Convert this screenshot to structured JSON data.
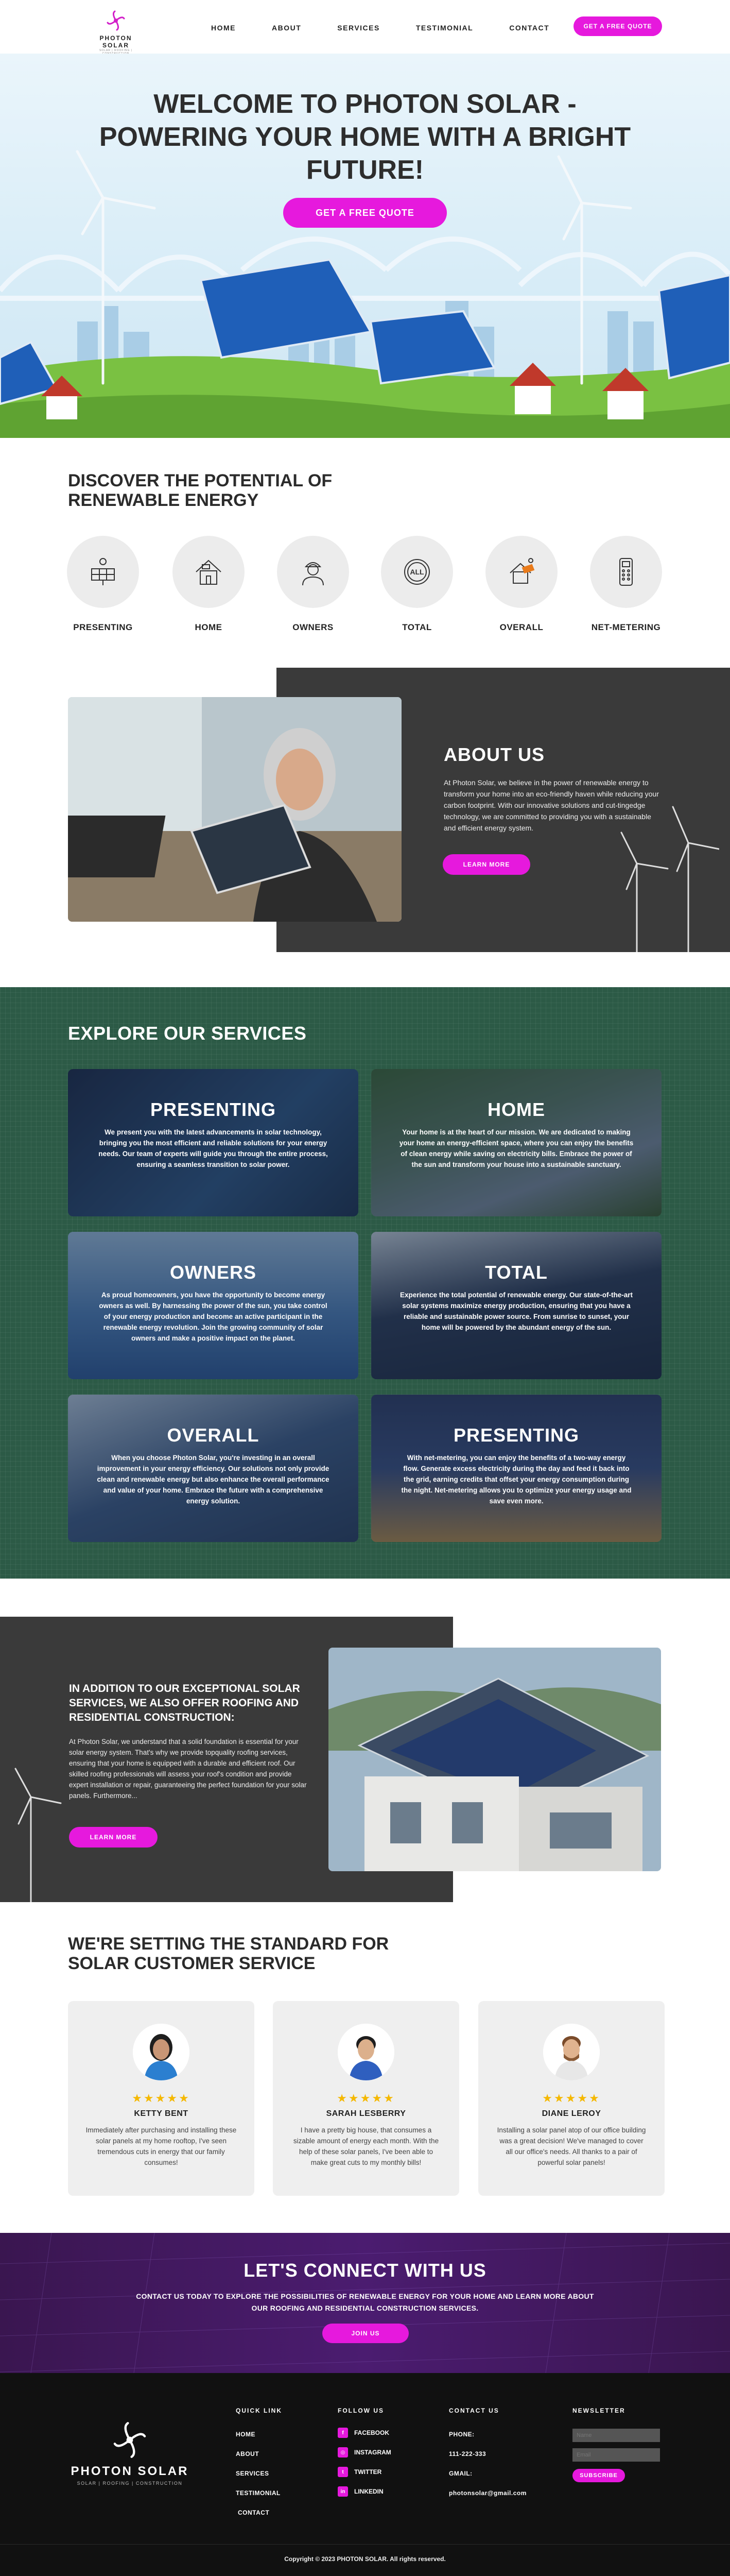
{
  "header": {
    "logo_text": "PHOTON SOLAR",
    "logo_sub": "SOLAR | ROOFING | CONSTRUCTION",
    "nav": [
      "HOME",
      "ABOUT",
      "SERVICES",
      "TESTIMONIAL",
      "CONTACT"
    ],
    "cta": "GET A FREE QUOTE"
  },
  "hero": {
    "title": "WELCOME TO PHOTON SOLAR - POWERING YOUR HOME WITH A BRIGHT FUTURE!",
    "cta": "GET A FREE QUOTE"
  },
  "discover": {
    "title": "DISCOVER THE POTENTIAL OF RENEWABLE ENERGY",
    "items": [
      "PRESENTING",
      "HOME",
      "OWNERS",
      "TOTAL",
      "OVERALL",
      "NET-METERING"
    ]
  },
  "about": {
    "title": "ABOUT US",
    "text": "At Photon Solar, we believe in the power of renewable energy to transform your home into an eco-friendly haven while reducing your carbon footprint. With our innovative solutions and cut-tingedge technology, we are committed to providing you with a sustainable and efficient energy system.",
    "cta": "LEARN MORE"
  },
  "services": {
    "title": "EXPLORE OUR SERVICES",
    "cards": [
      {
        "title": "PRESENTING",
        "text": "We present you with the latest advancements in solar technology, bringing you the most efficient and reliable solutions for your energy needs. Our team of experts will guide you through the entire process, ensuring a seamless transition to solar power."
      },
      {
        "title": "HOME",
        "text": "Your home is at the heart of our mission. We are dedicated to making your home an energy-efficient space, where you can enjoy the benefits of clean energy while saving on electricity bills. Embrace the power of the sun and transform your house into a sustainable sanctuary."
      },
      {
        "title": "OWNERS",
        "text": "As proud homeowners, you have the opportunity to become energy owners as well. By harnessing the power of the sun, you take control of your energy production and become an active participant in the renewable energy revolution. Join the growing community of solar owners and make a positive impact on the planet."
      },
      {
        "title": "TOTAL",
        "text": "Experience the total potential of renewable energy. Our state-of-the-art solar systems maximize energy production, ensuring that you have a reliable and sustainable power source. From sunrise to sunset, your home will be powered by the abundant energy of the sun."
      },
      {
        "title": "OVERALL",
        "text": "When you choose Photon Solar, you're investing in an overall improvement in your energy efficiency. Our solutions not only provide clean and renewable energy but also enhance the overall performance and value of your home. Embrace the future with a comprehensive energy solution."
      },
      {
        "title": "PRESENTING",
        "text": "With net-metering, you can enjoy the benefits of a two-way energy flow. Generate excess electricity during the day and feed it back into the grid, earning credits that offset your energy consumption during the night. Net-metering allows you to optimize your energy usage and save even more."
      }
    ]
  },
  "roofing": {
    "title": "IN ADDITION TO OUR EXCEPTIONAL SOLAR SERVICES, WE ALSO OFFER ROOFING AND RESIDENTIAL CONSTRUCTION:",
    "text": "At Photon Solar, we understand that a solid foundation is essential for your solar energy system. That's why we provide topquality roofing services, ensuring that your home is equipped with a durable and efficient roof. Our skilled roofing professionals will assess your roof's condition and provide expert installation or repair, guaranteeing the perfect foundation for your solar panels. Furthermore...",
    "cta": "LEARN MORE"
  },
  "testimonials": {
    "title": "WE'RE SETTING THE STANDARD FOR SOLAR CUSTOMER SERVICE",
    "items": [
      {
        "stars": "★★★★★",
        "name": "KETTY BENT",
        "quote": "Immediately after purchasing and installing these solar panels at my home rooftop, I've seen tremendous cuts in energy that our family consumes!"
      },
      {
        "stars": "★★★★★",
        "name": "SARAH LESBERRY",
        "quote": "I have a pretty big house, that consumes a sizable amount of energy each month. With the help of these solar panels, I've been able to make great cuts to my monthly bills!"
      },
      {
        "stars": "★★★★★",
        "name": "DIANE LEROY",
        "quote": "Installing a solar panel atop of our office building was a great decision! We've managed to cover all our office's needs. All thanks to a pair of powerful solar panels!"
      }
    ]
  },
  "connect": {
    "title": "LET'S CONNECT WITH US",
    "text": "CONTACT US TODAY TO EXPLORE THE POSSIBILITIES OF RENEWABLE ENERGY FOR YOUR HOME AND LEARN MORE ABOUT OUR ROOFING AND RESIDENTIAL CONSTRUCTION SERVICES.",
    "cta": "JOIN US"
  },
  "footer": {
    "logo_text": "PHOTON SOLAR",
    "logo_sub": "SOLAR | ROOFING | CONSTRUCTION",
    "quick_link_title": "QUICK LINK",
    "quick_links": [
      "HOME",
      "ABOUT",
      "SERVICES",
      "TESTIMONIAL",
      "CONTACT"
    ],
    "follow_title": "FOLLOW US",
    "social": [
      {
        "label": "FACEBOOK",
        "icon": "facebook-icon"
      },
      {
        "label": "INSTAGRAM",
        "icon": "instagram-icon"
      },
      {
        "label": "TWITTER",
        "icon": "twitter-icon"
      },
      {
        "label": "LINKEDIN",
        "icon": "linkedin-icon"
      }
    ],
    "contact_title": "CONTACT US",
    "phone_label": "PHONE:",
    "phone": "111-222-333",
    "email_label": "GMAIL:",
    "email": "photonsolar@gmail.com",
    "newsletter_title": "NEWSLETTER",
    "name_placeholder": "Name",
    "email_placeholder": "Email",
    "subscribe": "SUBSCRIBE",
    "copyright": "Copyright © 2023 PHOTON SOLAR. All rights reserved."
  },
  "colors": {
    "accent": "#e619dd",
    "dark": "#3a3a3a",
    "services_bg": "#2c5a46",
    "connect_bg": "#4b1c70"
  }
}
